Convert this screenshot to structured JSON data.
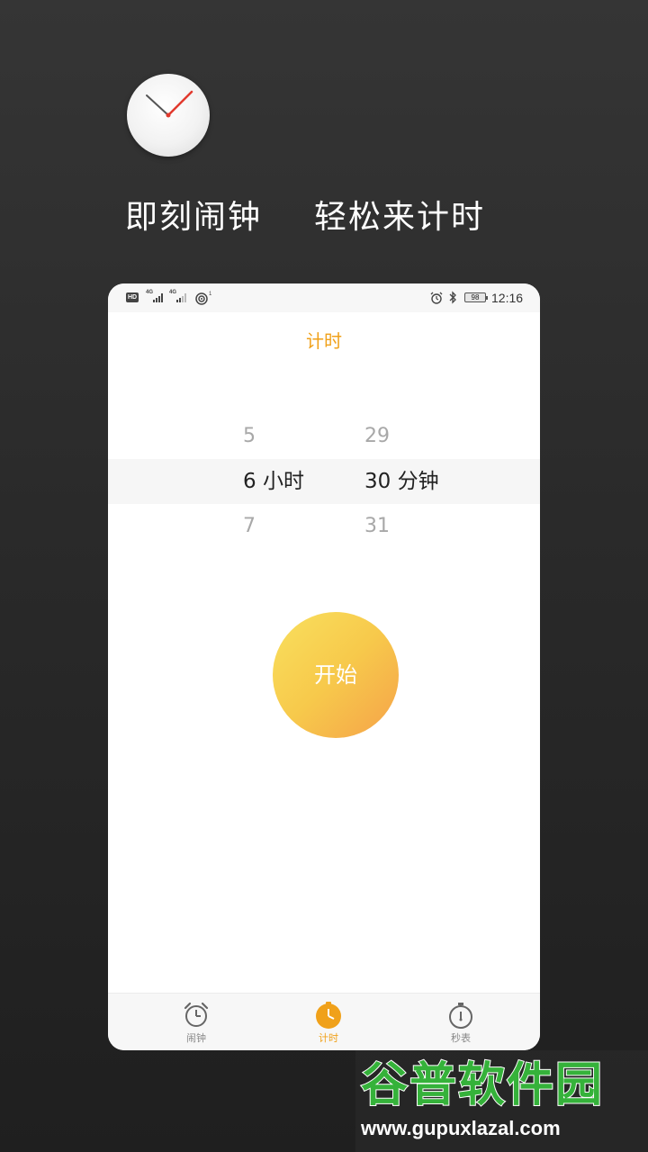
{
  "headline": {
    "left": "即刻闹钟",
    "right": "轻松来计时"
  },
  "status_bar": {
    "left_badges": [
      "HD",
      "4G",
      "4G"
    ],
    "battery": "98",
    "time": "12:16"
  },
  "timer_page": {
    "title": "计时",
    "hours": {
      "prev": "5",
      "selected": "6 小时",
      "next": "7"
    },
    "minutes": {
      "prev": "29",
      "selected": "30 分钟",
      "next": "31"
    },
    "start_button": "开始"
  },
  "tabbar": {
    "items": [
      {
        "label": "闹钟",
        "icon": "alarm-clock-icon",
        "active": false
      },
      {
        "label": "计时",
        "icon": "timer-icon",
        "active": true
      },
      {
        "label": "秒表",
        "icon": "stopwatch-icon",
        "active": false
      }
    ]
  },
  "watermark": {
    "title": "谷普软件园",
    "url": "www.gupuxlazal.com"
  },
  "colors": {
    "accent": "#f0a11a",
    "button_start": "#f9e05e",
    "button_end": "#f5a24a",
    "background": "#2a2a2a"
  }
}
